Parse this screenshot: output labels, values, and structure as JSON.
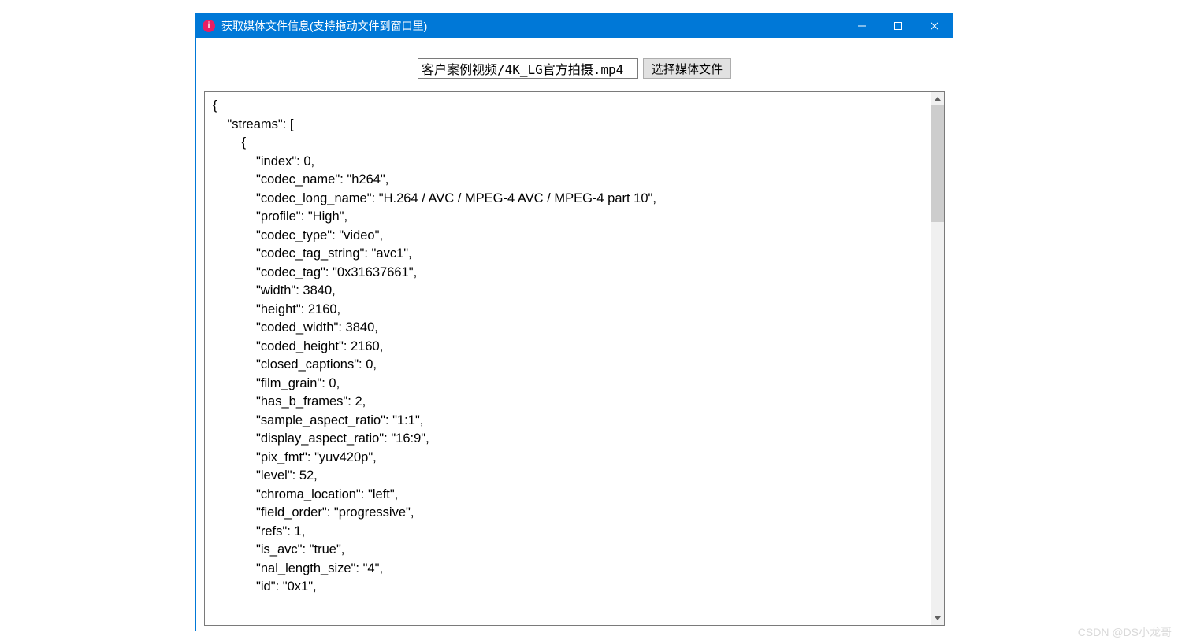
{
  "window": {
    "title": "获取媒体文件信息(支持拖动文件到窗口里)"
  },
  "toolbar": {
    "file_path": "客户案例视频/4K_LG官方拍摄.mp4",
    "select_button_label": "选择媒体文件"
  },
  "output": {
    "text": "{\n    \"streams\": [\n        {\n            \"index\": 0,\n            \"codec_name\": \"h264\",\n            \"codec_long_name\": \"H.264 / AVC / MPEG-4 AVC / MPEG-4 part 10\",\n            \"profile\": \"High\",\n            \"codec_type\": \"video\",\n            \"codec_tag_string\": \"avc1\",\n            \"codec_tag\": \"0x31637661\",\n            \"width\": 3840,\n            \"height\": 2160,\n            \"coded_width\": 3840,\n            \"coded_height\": 2160,\n            \"closed_captions\": 0,\n            \"film_grain\": 0,\n            \"has_b_frames\": 2,\n            \"sample_aspect_ratio\": \"1:1\",\n            \"display_aspect_ratio\": \"16:9\",\n            \"pix_fmt\": \"yuv420p\",\n            \"level\": 52,\n            \"chroma_location\": \"left\",\n            \"field_order\": \"progressive\",\n            \"refs\": 1,\n            \"is_avc\": \"true\",\n            \"nal_length_size\": \"4\",\n            \"id\": \"0x1\","
  },
  "watermark": "CSDN @DS小龙哥"
}
